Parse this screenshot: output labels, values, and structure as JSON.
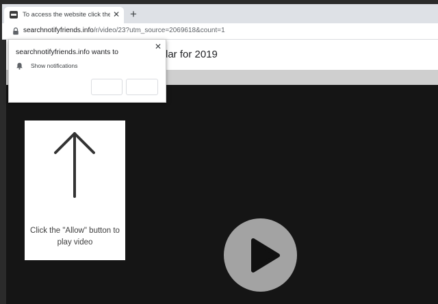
{
  "browser": {
    "tab": {
      "title": "To access the website click the \"Allow\" button",
      "close_glyph": "✕"
    },
    "new_tab_glyph": "+",
    "address_bar": {
      "domain": "searchnotifyfriends.info",
      "path": "/r/video/23?utm_source=2069618&count=1"
    }
  },
  "page": {
    "header_text": "lar for 2019",
    "instruction_card": {
      "text": "Click the \"Allow\" button to play video"
    }
  },
  "notification_prompt": {
    "title": "searchnotifyfriends.info wants to",
    "permission": "Show notifications",
    "close_glyph": "✕",
    "allow_label": "",
    "block_label": ""
  },
  "colors": {
    "page_background": "#151515",
    "play_button": "#a3a3a3",
    "tabstrip": "#dee1e6"
  }
}
